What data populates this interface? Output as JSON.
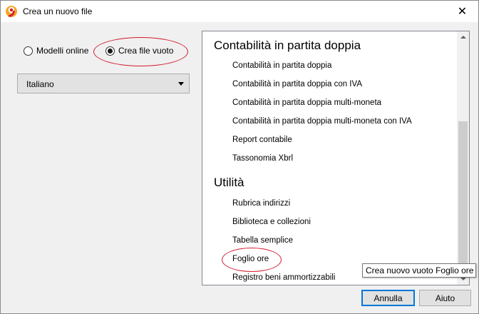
{
  "window": {
    "title": "Crea un nuovo file",
    "close_glyph": "✕",
    "app_icon": "banana-accounting-icon",
    "accent_color": "#d21b2f"
  },
  "source": {
    "options": [
      {
        "label": "Modelli online",
        "selected": false
      },
      {
        "label": "Crea file vuoto",
        "selected": true
      }
    ]
  },
  "language": {
    "selected": "Italiano"
  },
  "list": {
    "groups": [
      {
        "title": "Contabilità in partita doppia",
        "items": [
          "Contabilità in partita doppia",
          "Contabilità in partita doppia con IVA",
          "Contabilità in partita doppia multi-moneta",
          "Contabilità in partita doppia multi-moneta con IVA",
          "Report contabile",
          "Tassonomia Xbrl"
        ]
      },
      {
        "title": "Utilità",
        "items": [
          "Rubrica indirizzi",
          "Biblioteca e collezioni",
          "Tabella semplice",
          "Foglio ore",
          "Registro beni ammortizzabili"
        ]
      }
    ]
  },
  "tooltip": {
    "text": "Crea nuovo vuoto Foglio ore"
  },
  "buttons": {
    "cancel_label": "Annulla",
    "help_label": "Aiuto"
  }
}
